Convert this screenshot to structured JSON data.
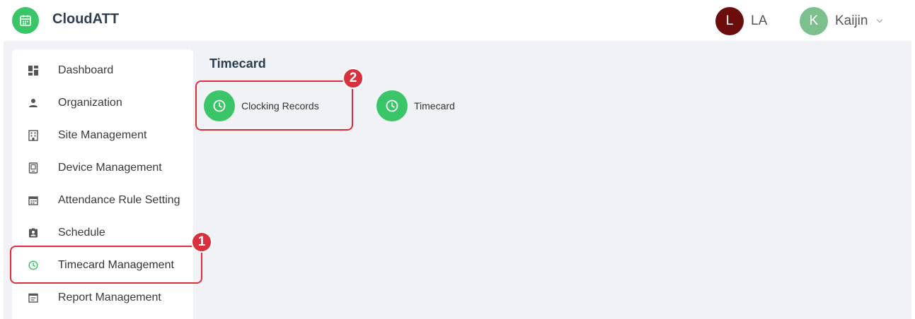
{
  "header": {
    "app_title": "CloudATT",
    "logo_icon": "calendar-icon",
    "users": [
      {
        "initial": "L",
        "name": "LA",
        "color": "#6b0d0d"
      },
      {
        "initial": "K",
        "name": "Kaijin",
        "color": "#7cc08e"
      }
    ]
  },
  "sidebar": {
    "items": [
      {
        "label": "Dashboard",
        "icon": "dashboard-icon"
      },
      {
        "label": "Organization",
        "icon": "person-icon"
      },
      {
        "label": "Site Management",
        "icon": "building-icon"
      },
      {
        "label": "Device Management",
        "icon": "device-icon"
      },
      {
        "label": "Attendance Rule Setting",
        "icon": "calendar-icon"
      },
      {
        "label": "Schedule",
        "icon": "badge-icon"
      },
      {
        "label": "Timecard Management",
        "icon": "clock-icon",
        "active": true
      },
      {
        "label": "Report Management",
        "icon": "report-icon"
      }
    ]
  },
  "main": {
    "title": "Timecard",
    "tiles": [
      {
        "label": "Clocking Records",
        "icon": "clock-icon"
      },
      {
        "label": "Timecard",
        "icon": "clock-icon"
      }
    ]
  },
  "annotations": [
    {
      "number": "1"
    },
    {
      "number": "2"
    }
  ],
  "colors": {
    "accent_green": "#3ac569",
    "annotation_red": "#d9303e",
    "background": "#f0f2f5"
  }
}
